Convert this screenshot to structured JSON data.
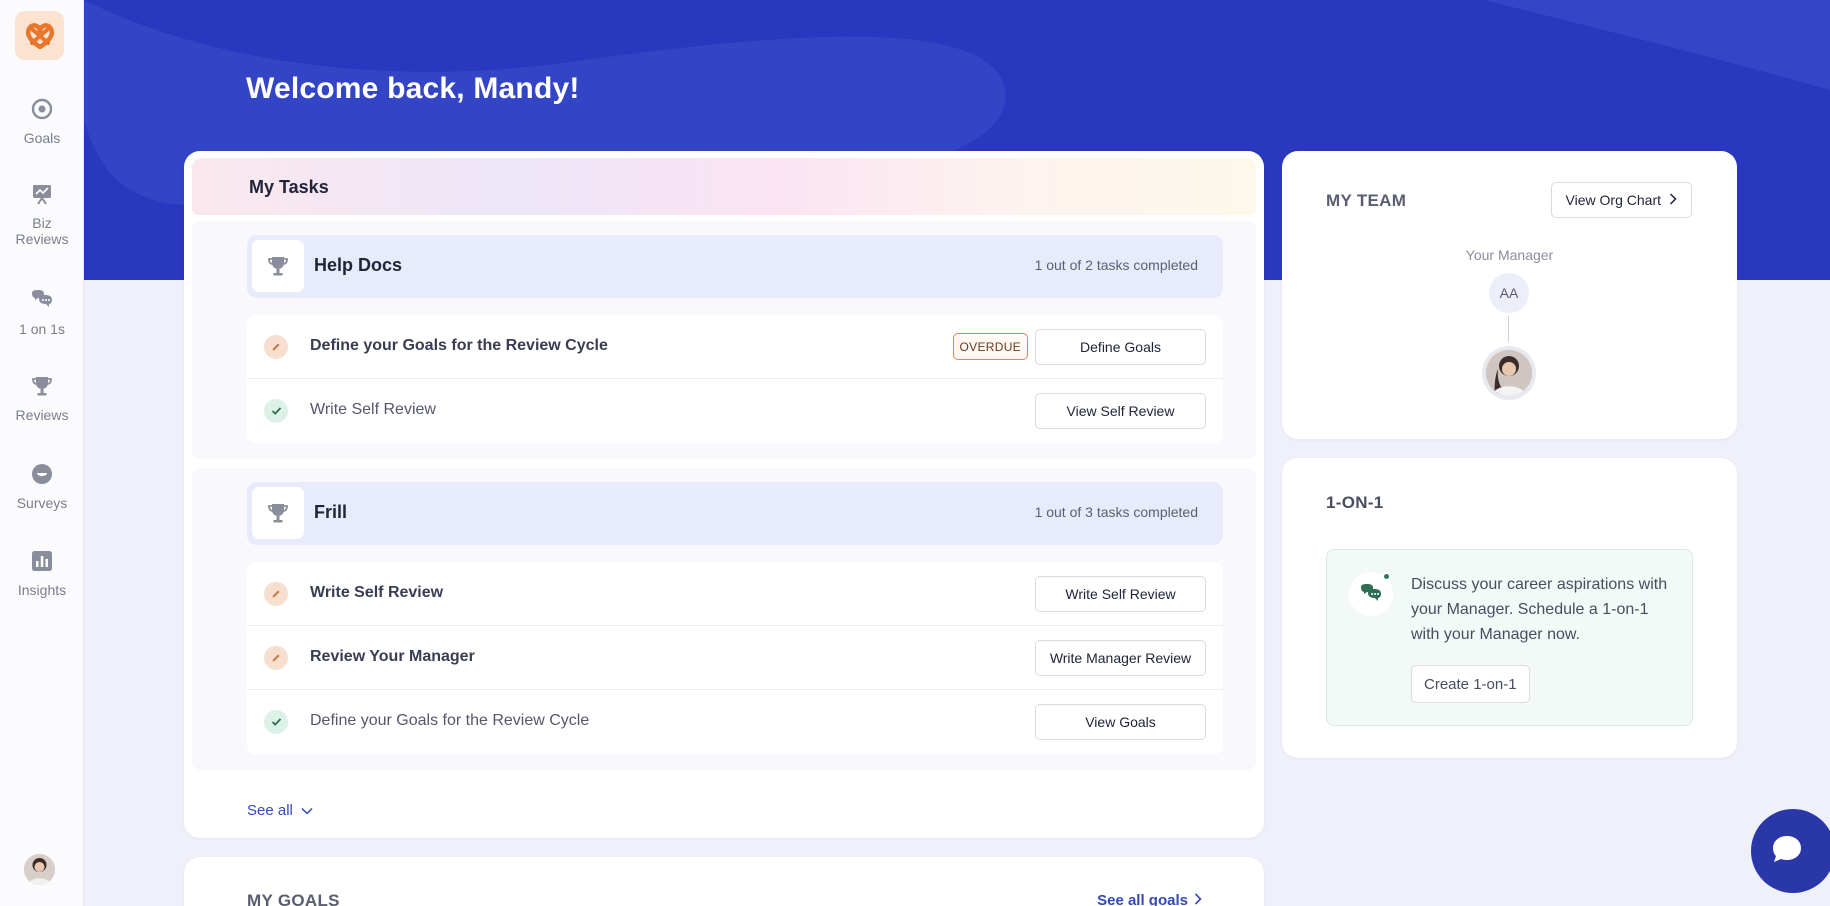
{
  "sidebar": {
    "logo_icon": "pretzel-logo-icon",
    "items": [
      {
        "label": "Goals",
        "icon": "target-icon"
      },
      {
        "label": "Biz Reviews",
        "icon": "presentation-icon"
      },
      {
        "label": "1 on 1s",
        "icon": "chat-bubbles-icon"
      },
      {
        "label": "Reviews",
        "icon": "trophy-icon"
      },
      {
        "label": "Surveys",
        "icon": "survey-icon"
      },
      {
        "label": "Insights",
        "icon": "bar-chart-icon"
      }
    ],
    "avatar_icon": "user-avatar"
  },
  "header": {
    "welcome": "Welcome back, Mandy!"
  },
  "tasks": {
    "title": "My Tasks",
    "groups": [
      {
        "name": "Help Docs",
        "progress": "1 out of 2 tasks completed",
        "items": [
          {
            "label": "Define your Goals for the Review Cycle",
            "status": "pending",
            "badge": "OVERDUE",
            "button": "Define Goals"
          },
          {
            "label": "Write Self Review",
            "status": "done",
            "button": "View Self Review"
          }
        ]
      },
      {
        "name": "Frill",
        "progress": "1 out of 3 tasks completed",
        "items": [
          {
            "label": "Write Self Review",
            "status": "pending",
            "button": "Write Self Review"
          },
          {
            "label": "Review Your Manager",
            "status": "pending",
            "button": "Write Manager Review"
          },
          {
            "label": "Define your Goals for the Review Cycle",
            "status": "done",
            "button": "View Goals"
          }
        ]
      }
    ],
    "see_all": "See all"
  },
  "goals": {
    "title": "MY GOALS",
    "link": "See all goals"
  },
  "team": {
    "title": "MY TEAM",
    "org_button": "View Org Chart",
    "manager_label": "Your Manager",
    "manager_initials": "AA"
  },
  "one_on_one": {
    "title": "1-ON-1",
    "message": "Discuss your career aspirations with your Manager. Schedule a 1-on-1 with your Manager now.",
    "button": "Create 1-on-1"
  },
  "colors": {
    "hero": "#2a37bf",
    "accent": "#3548b8",
    "overdue_border": "#d98859",
    "done_green": "#2e7a5a"
  }
}
